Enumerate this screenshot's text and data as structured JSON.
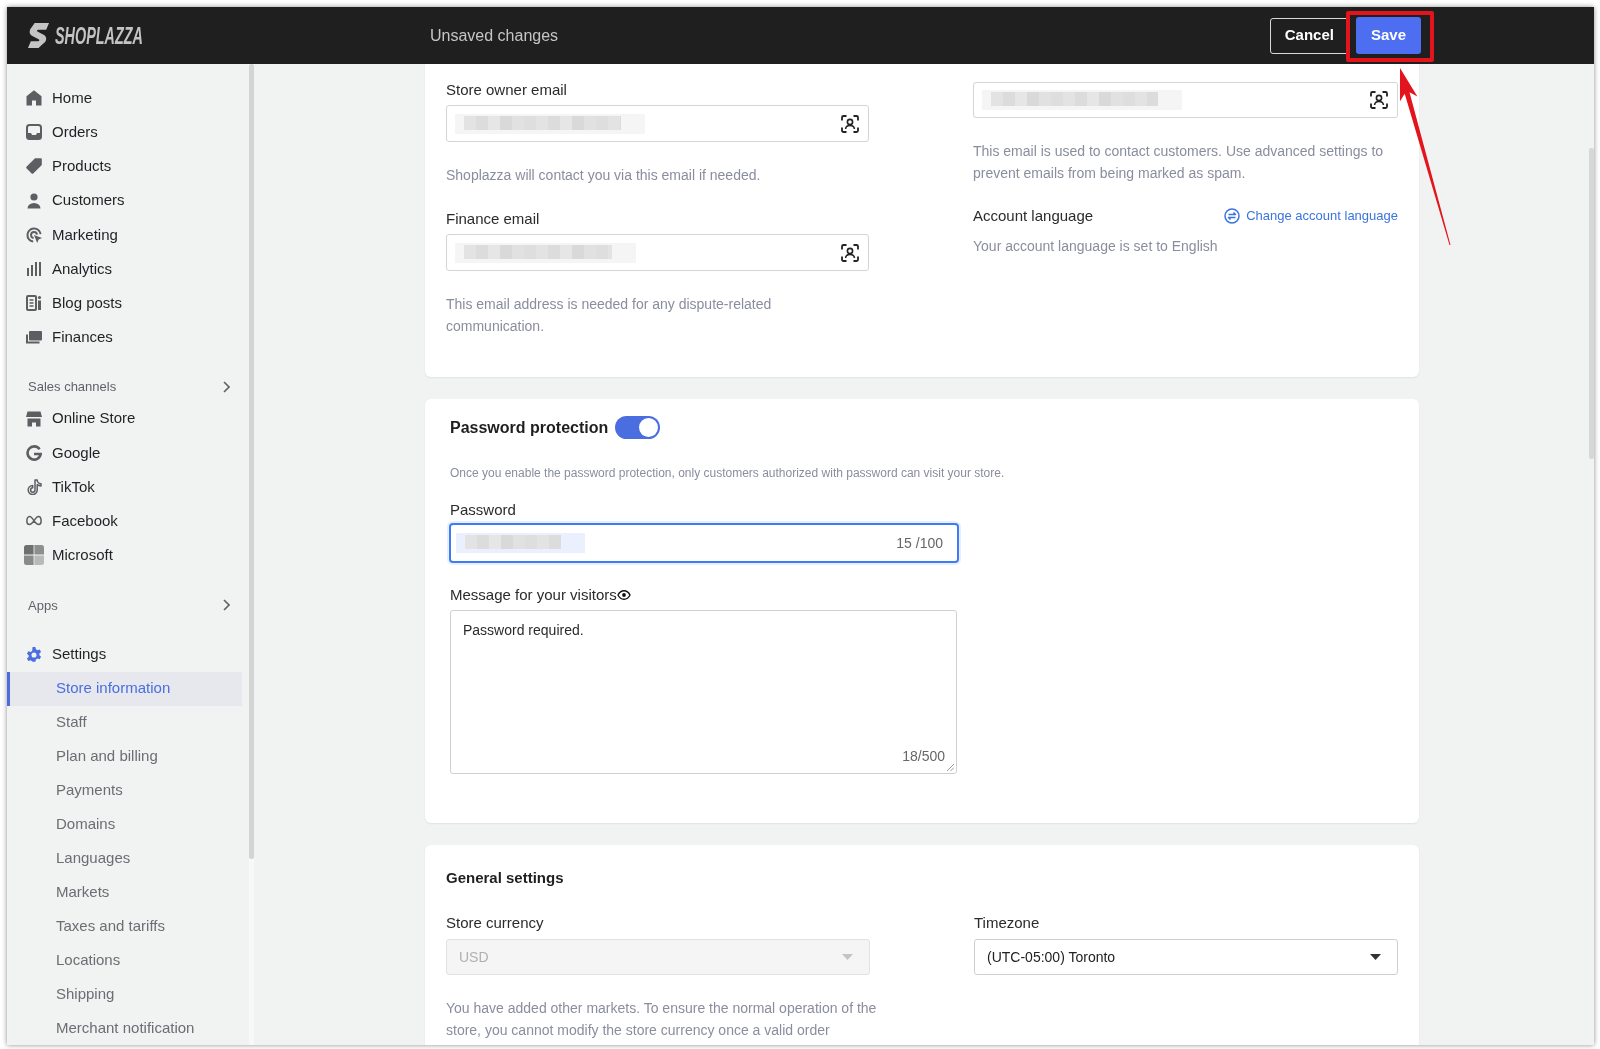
{
  "top_bar": {
    "logo": "SHOPLAZZA",
    "title": "Unsaved changes",
    "buttons": [
      {
        "label": "Cancel",
        "kind": "secondary",
        "highlighted": false
      },
      {
        "label": "Save",
        "kind": "primary",
        "highlighted": true
      }
    ]
  },
  "sidebar": {
    "items": [
      {
        "label": "Home",
        "selected": false
      },
      {
        "label": "Orders",
        "selected": false
      },
      {
        "label": "Products",
        "selected": false
      },
      {
        "label": "Customers",
        "selected": false
      },
      {
        "label": "Marketing",
        "selected": false
      },
      {
        "label": "Analytics",
        "selected": false
      },
      {
        "label": "Blog posts",
        "selected": false
      },
      {
        "label": "Finances",
        "selected": false
      }
    ],
    "sales_channels": {
      "title": "Sales channels",
      "items": [
        {
          "label": "Online Store",
          "selected": false
        },
        {
          "label": "Google",
          "selected": false
        },
        {
          "label": "TikTok",
          "selected": false
        },
        {
          "label": "Facebook",
          "selected": false
        },
        {
          "label": "Microsoft",
          "selected": false
        }
      ]
    },
    "apps": {
      "title": "Apps"
    },
    "settings": {
      "label": "Settings",
      "expanded": true,
      "children": [
        {
          "label": "Store information",
          "selected": true
        },
        {
          "label": "Staff",
          "selected": false
        },
        {
          "label": "Plan and billing",
          "selected": false
        },
        {
          "label": "Payments",
          "selected": false
        },
        {
          "label": "Domains",
          "selected": false
        },
        {
          "label": "Languages",
          "selected": false
        },
        {
          "label": "Markets",
          "selected": false
        },
        {
          "label": "Taxes and tariffs",
          "selected": false
        },
        {
          "label": "Locations",
          "selected": false
        },
        {
          "label": "Shipping",
          "selected": false
        },
        {
          "label": "Merchant notification",
          "selected": false
        }
      ]
    }
  },
  "contact_card": {
    "left": [
      {
        "label": "Store owner email",
        "redacted": true,
        "help": "Shoplazza will contact you via this email if needed."
      },
      {
        "label": "Finance email",
        "redacted": true,
        "help": "This email address is needed for any dispute-related communication."
      }
    ],
    "customer_service": {
      "redacted": true,
      "help": "This email is used to contact customers. Use advanced settings to prevent emails from being marked as spam."
    },
    "account_language": {
      "label": "Account language",
      "link": "Change account language",
      "text": "Your account language is set to English"
    }
  },
  "password_card": {
    "title": "Password protection",
    "on": true,
    "description": "Once you enable the password protection, only customers authorized with password can visit your store.",
    "password": {
      "label": "Password",
      "redacted": true,
      "focused": true,
      "counter": "15 /100"
    },
    "message": {
      "label": "Message for your visitors",
      "value": "Password required.",
      "counter": "18/500"
    }
  },
  "general_card": {
    "title": "General settings",
    "currency": {
      "label": "Store currency",
      "value": "USD",
      "disabled": true,
      "help": "You have added other markets. To ensure the normal operation of the store, you cannot modify the store currency once a valid order"
    },
    "timezone": {
      "label": "Timezone",
      "value": "(UTC-05:00) Toronto",
      "disabled": false
    }
  }
}
